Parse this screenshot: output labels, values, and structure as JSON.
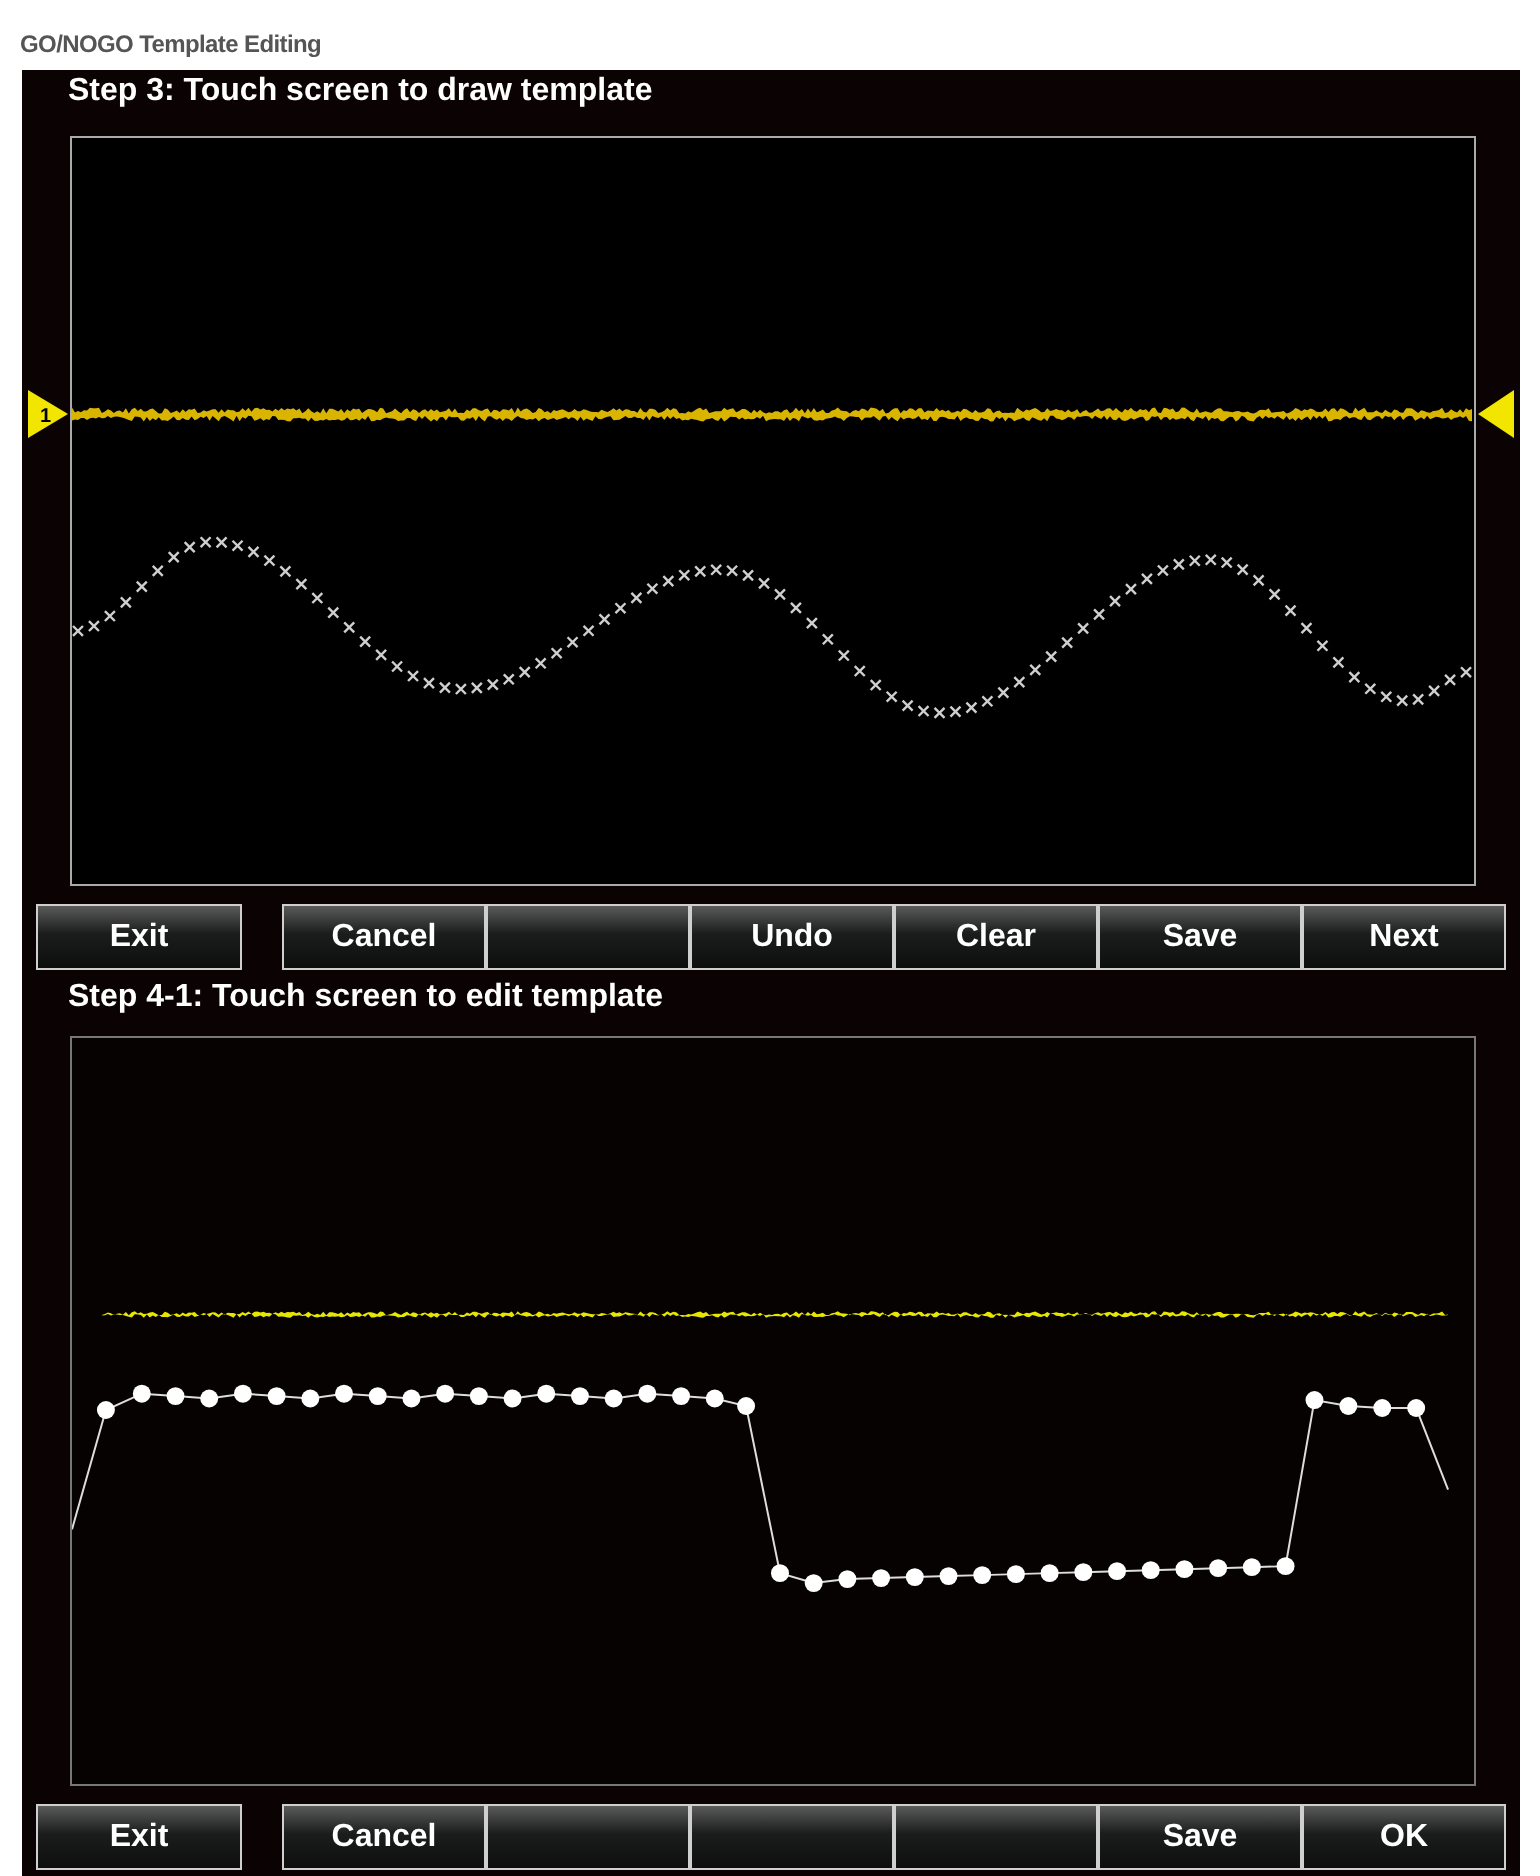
{
  "title": "GO/NOGO Template Editing",
  "panels": [
    {
      "kind": "draw",
      "heading": "Step 3: Touch screen to draw template",
      "channel_marker": "1",
      "buttons": [
        {
          "kind": "label",
          "label": "Exit"
        },
        {
          "kind": "label",
          "label": "Cancel"
        },
        {
          "kind": "blank"
        },
        {
          "kind": "label",
          "label": "Undo"
        },
        {
          "kind": "label",
          "label": "Clear"
        },
        {
          "kind": "label",
          "label": "Save"
        },
        {
          "kind": "label",
          "label": "Next"
        }
      ]
    },
    {
      "kind": "edit",
      "heading": "Step 4-1: Touch screen to edit template",
      "buttons": [
        {
          "kind": "label",
          "label": "Exit"
        },
        {
          "kind": "label",
          "label": "Cancel"
        },
        {
          "kind": "blank"
        },
        {
          "kind": "blank"
        },
        {
          "kind": "blank"
        },
        {
          "kind": "label",
          "label": "Save"
        },
        {
          "kind": "label",
          "label": "OK"
        }
      ]
    }
  ]
}
